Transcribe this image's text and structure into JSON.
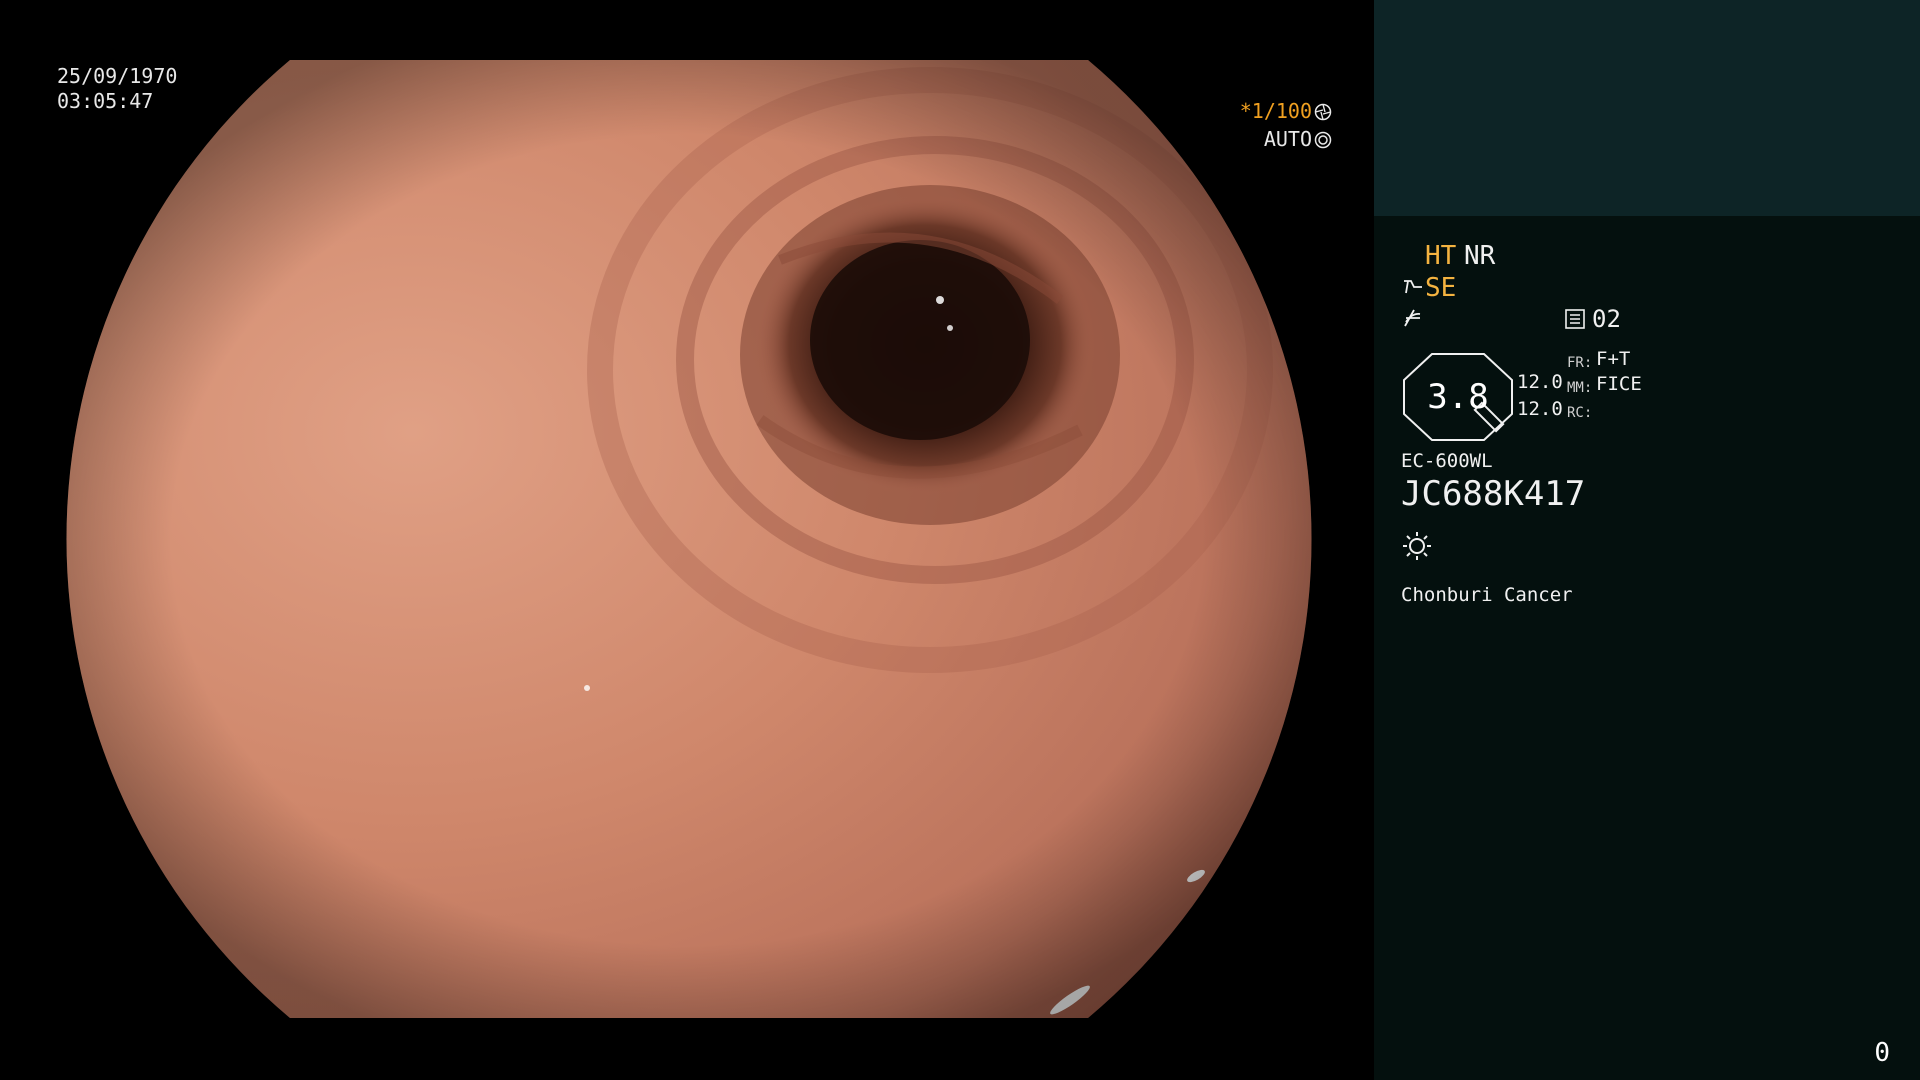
{
  "overlay": {
    "date": "25/09/1970",
    "time": "03:05:47",
    "shutter": "*1/100",
    "auto": "AUTO",
    "shutter_icon": "aperture-icon",
    "auto_icon": "iris-mode-icon"
  },
  "panel": {
    "ht": "HT",
    "nr": "NR",
    "se": "SE",
    "se_icon": "structure-enhance-icon",
    "gamma_icon": "gamma-curve-icon",
    "memory_icon": "memory-card-icon",
    "memory_value": "02",
    "iris_value": "3.8",
    "fr_label": "FR:",
    "fr_value": "F+T",
    "mm_label": "MM:",
    "mm_value": "FICE",
    "rc_label": "RC:",
    "rc_value": "",
    "left_val_1": "12.0",
    "left_val_2": "12.0",
    "scope_model": "EC-600WL",
    "scope_serial": "JC688K417",
    "light_icon": "light-sun-icon",
    "institution": "Chonburi Cancer",
    "frame_counter": "0"
  },
  "colors": {
    "panel_bg": "#04100e",
    "panel_top_bg": "#0d2426",
    "accent_yellow": "#f4b340",
    "tissue": "#c98066"
  }
}
